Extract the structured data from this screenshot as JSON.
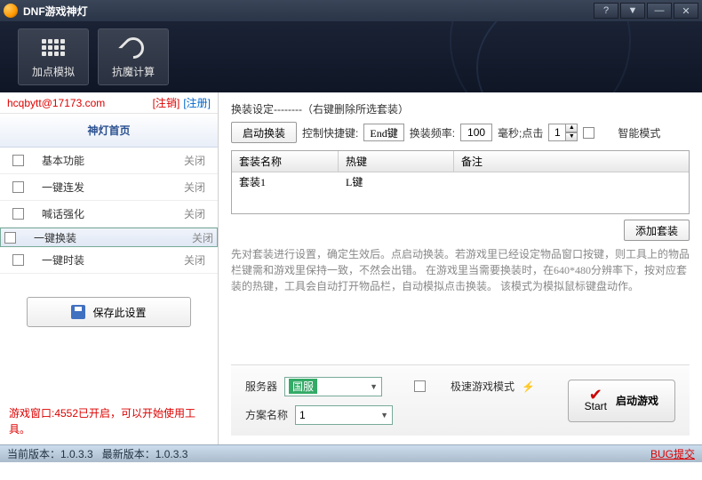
{
  "title": "DNF游戏神灯",
  "toolbar": {
    "sim": "加点模拟",
    "calc": "抗魔计算"
  },
  "user": {
    "name": "hcqbytt@17173.com",
    "logout": "[注销]",
    "register": "[注册]"
  },
  "nav": {
    "header": "神灯首页",
    "items": [
      {
        "label": "基本功能",
        "state": "关闭"
      },
      {
        "label": "一键连发",
        "state": "关闭"
      },
      {
        "label": "喊话强化",
        "state": "关闭"
      },
      {
        "label": "一键换装",
        "state": "关闭"
      },
      {
        "label": "一键时装",
        "state": "关闭"
      }
    ],
    "save": "保存此设置"
  },
  "gameinfo": "游戏窗口:4552已开启，可以开始使用工具。",
  "panel": {
    "title": "换装设定--------（右键删除所选套装）",
    "start_btn": "启动换装",
    "hotkey_lbl": "控制快捷键:",
    "hotkey_val": "End键",
    "freq_lbl": "换装频率:",
    "freq_val": "100",
    "freq_unit": "毫秒;点击",
    "click_val": "1",
    "smart": "智能模式",
    "cols": {
      "c1": "套装名称",
      "c2": "热键",
      "c3": "备注"
    },
    "rows": [
      {
        "name": "套装1",
        "key": "L键",
        "note": ""
      }
    ],
    "add": "添加套装",
    "help": "先对套装进行设置，确定生效后。点启动换装。若游戏里已经设定物品窗口按键，则工具上的物品栏键需和游戏里保持一致，不然会出错。\n在游戏里当需要换装时，在640*480分辨率下，按对应套装的热键，工具会自动打开物品栏，自动模拟点击换装。   该模式为模拟鼠标键盘动作。"
  },
  "bottom": {
    "server_lbl": "服务器",
    "server_val": "国服",
    "fast_lbl": "极速游戏模式",
    "scheme_lbl": "方案名称",
    "scheme_val": "1",
    "start": "启动游戏",
    "start_sub": "Start"
  },
  "status": {
    "cur": "当前版本：1.0.3.3",
    "new": "最新版本：1.0.3.3",
    "bug": "BUG提交"
  }
}
